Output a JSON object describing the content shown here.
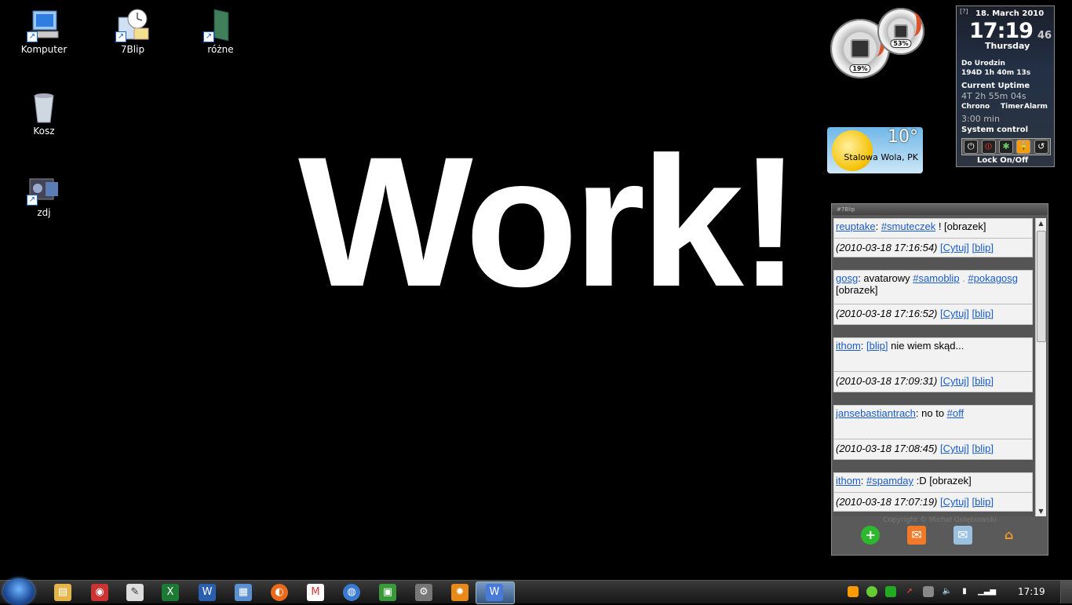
{
  "desktop": {
    "icons": [
      {
        "label": "Komputer"
      },
      {
        "label": "7Blip"
      },
      {
        "label": "różne"
      },
      {
        "label": "Kosz"
      },
      {
        "label": "zdj"
      }
    ],
    "wallpaper_text": "Work!"
  },
  "gauges": {
    "cpu_percent": "19%",
    "mem_percent": "53%"
  },
  "clock_gadget": {
    "help": "[?]",
    "date": "18. March 2010",
    "time": "17:19",
    "seconds": "46",
    "day": "Thursday",
    "countdown_label": "Do Urodzin",
    "countdown_value": "194D 1h 40m 13s",
    "uptime_label": "Current Uptime",
    "uptime_value": "4T 2h 55m 04s",
    "tabs": [
      "Chrono",
      "Timer",
      "Alarm"
    ],
    "timer_value": "3:00 min",
    "system_control_label": "System control",
    "lock_label": "Lock On/Off"
  },
  "weather": {
    "temperature": "10°",
    "location": "Stalowa Wola, PK"
  },
  "blip": {
    "header": "#7Blip",
    "posts": [
      {
        "user": "reuptake",
        "tag1": "#smuteczek",
        "text": " ! [obrazek]",
        "date": "(2010-03-18 17:16:54)"
      },
      {
        "user": "gosg",
        "tag1": "#samoblip",
        "text_before": ": avatarowy ",
        "sep": " . ",
        "tag2": "#pokagosg",
        "text": " [obrazek]",
        "date": "(2010-03-18 17:16:52)"
      },
      {
        "user": "ithom",
        "tag1": "[blip]",
        "text": " nie wiem skąd...",
        "date": "(2010-03-18 17:09:31)"
      },
      {
        "user": "jansebastiantrach",
        "text_before": ": no to ",
        "tag1": "#off",
        "date": "(2010-03-18 17:08:45)"
      },
      {
        "user": "ithom",
        "tag1": "#spamday",
        "text": " :D [obrazek]",
        "date": "(2010-03-18 17:07:19)"
      }
    ],
    "cite_label": "[Cytuj]",
    "blip_label": "[blip]",
    "copyright": "Copyright © Michał Gołębiowski"
  },
  "taskbar": {
    "time": "17:19"
  }
}
